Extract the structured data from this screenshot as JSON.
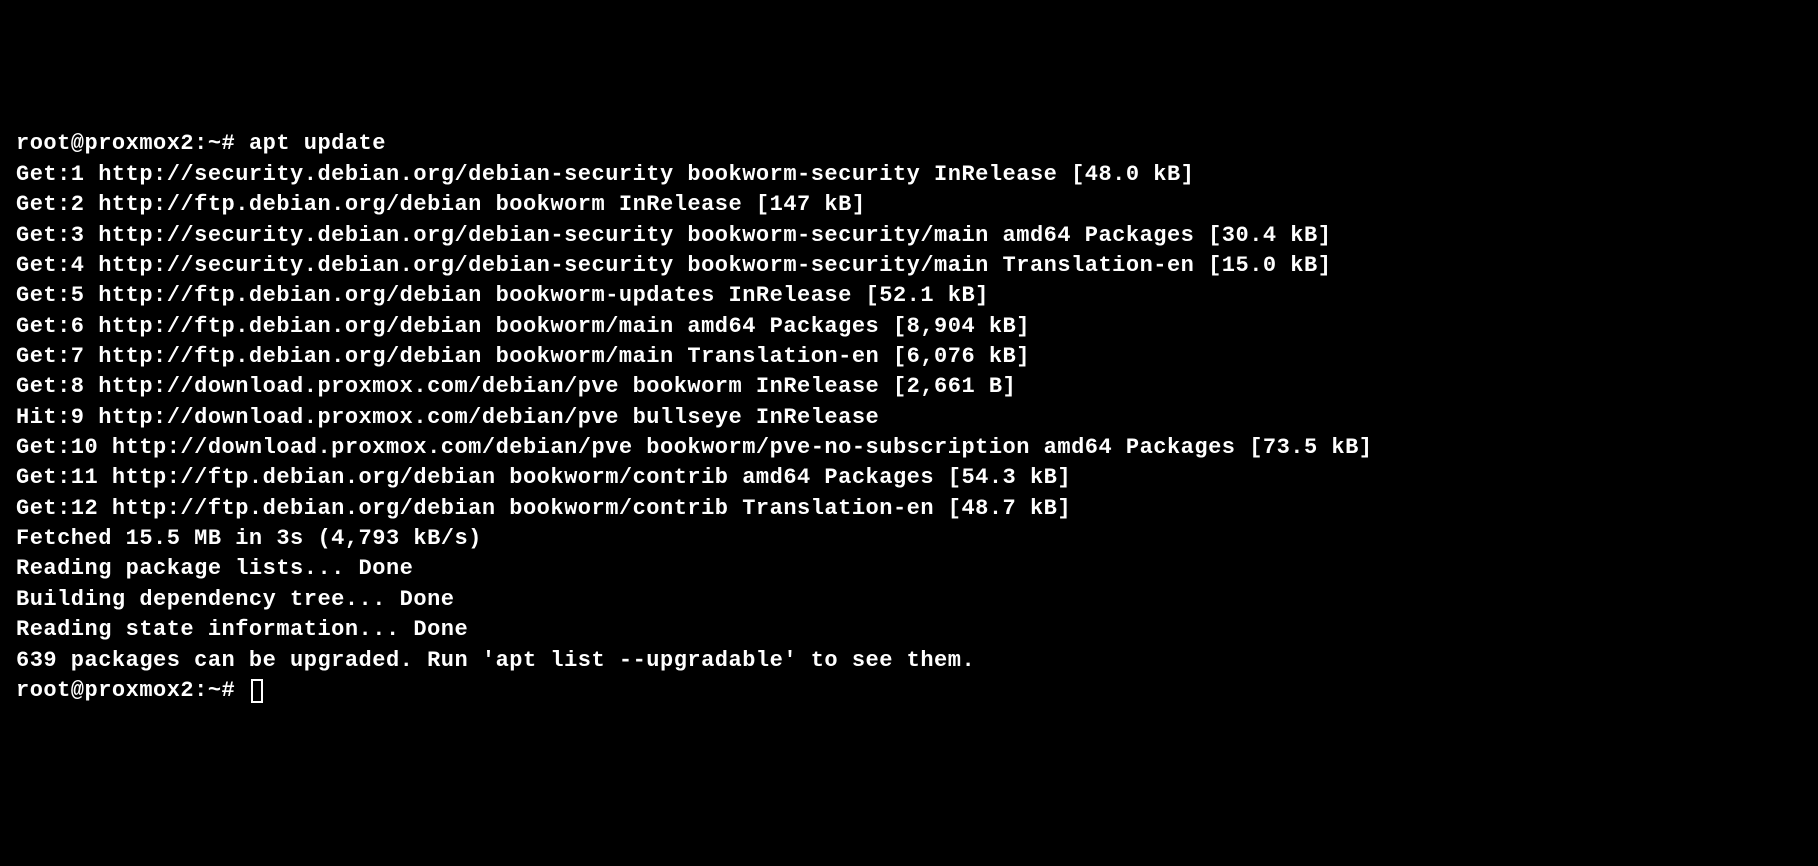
{
  "terminal": {
    "prompt": "root@proxmox2:~#",
    "command": "apt update",
    "lines": [
      "Get:1 http://security.debian.org/debian-security bookworm-security InRelease [48.0 kB]",
      "Get:2 http://ftp.debian.org/debian bookworm InRelease [147 kB]",
      "Get:3 http://security.debian.org/debian-security bookworm-security/main amd64 Packages [30.4 kB]",
      "Get:4 http://security.debian.org/debian-security bookworm-security/main Translation-en [15.0 kB]",
      "Get:5 http://ftp.debian.org/debian bookworm-updates InRelease [52.1 kB]",
      "Get:6 http://ftp.debian.org/debian bookworm/main amd64 Packages [8,904 kB]",
      "Get:7 http://ftp.debian.org/debian bookworm/main Translation-en [6,076 kB]",
      "Get:8 http://download.proxmox.com/debian/pve bookworm InRelease [2,661 B]",
      "Hit:9 http://download.proxmox.com/debian/pve bullseye InRelease",
      "Get:10 http://download.proxmox.com/debian/pve bookworm/pve-no-subscription amd64 Packages [73.5 kB]",
      "Get:11 http://ftp.debian.org/debian bookworm/contrib amd64 Packages [54.3 kB]",
      "Get:12 http://ftp.debian.org/debian bookworm/contrib Translation-en [48.7 kB]",
      "Fetched 15.5 MB in 3s (4,793 kB/s)",
      "Reading package lists... Done",
      "Building dependency tree... Done",
      "Reading state information... Done",
      "639 packages can be upgraded. Run 'apt list --upgradable' to see them."
    ]
  }
}
